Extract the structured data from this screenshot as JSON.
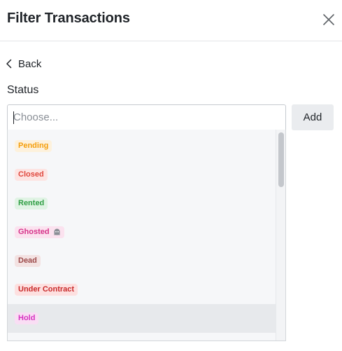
{
  "dialog": {
    "title": "Filter Transactions",
    "back_label": "Back"
  },
  "status": {
    "label": "Status",
    "placeholder": "Choose...",
    "add_label": "Add"
  },
  "options": [
    {
      "label": "Pending",
      "color": "#f59e0b",
      "bg": "#fdf1dc"
    },
    {
      "label": "Closed",
      "color": "#e0483e",
      "bg": "#fde4e2"
    },
    {
      "label": "Rented",
      "color": "#2f9e44",
      "bg": "#e0f3e4"
    },
    {
      "label": "Ghosted",
      "color": "#d6338a",
      "bg": "#fbe2ef",
      "icon": "ghost-icon"
    },
    {
      "label": "Dead",
      "color": "#9c4a4a",
      "bg": "#f3e2e2"
    },
    {
      "label": "Under Contract",
      "color": "#c92a2a",
      "bg": "#fde0e0"
    },
    {
      "label": "Hold",
      "color": "#d633c0",
      "bg": "#f9def4",
      "highlighted": true
    }
  ],
  "icons": {
    "close": "close-icon",
    "back": "chevron-left-icon"
  }
}
